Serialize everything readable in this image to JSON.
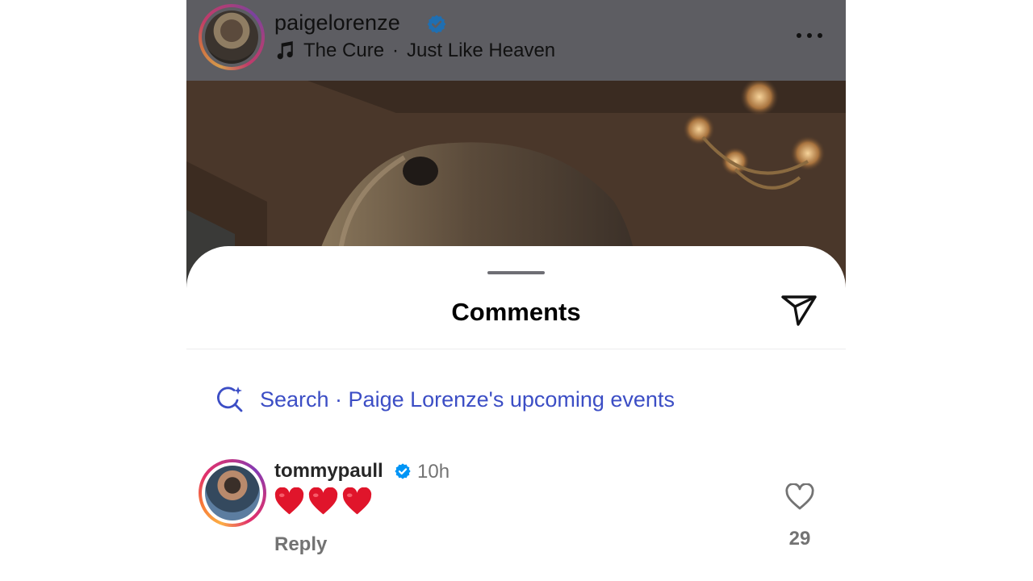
{
  "post": {
    "username": "paigelorenze",
    "music": {
      "artist": "The Cure",
      "separator": "·",
      "track": "Just Like Heaven"
    },
    "verified_icon": "verified-badge-icon",
    "more_icon": "more-horizontal-icon"
  },
  "sheet": {
    "title": "Comments",
    "share_icon": "send-icon",
    "search_suggestion": "Search · Paige Lorenze's upcoming events"
  },
  "comments": [
    {
      "username": "tommypaull",
      "time": "10h",
      "text": "❤️❤️❤️",
      "reply_label": "Reply",
      "like_count": "29"
    }
  ],
  "colors": {
    "accent_link": "#3c4ec5",
    "verified_blue": "#0095f6",
    "heart_red": "#e0152b"
  }
}
